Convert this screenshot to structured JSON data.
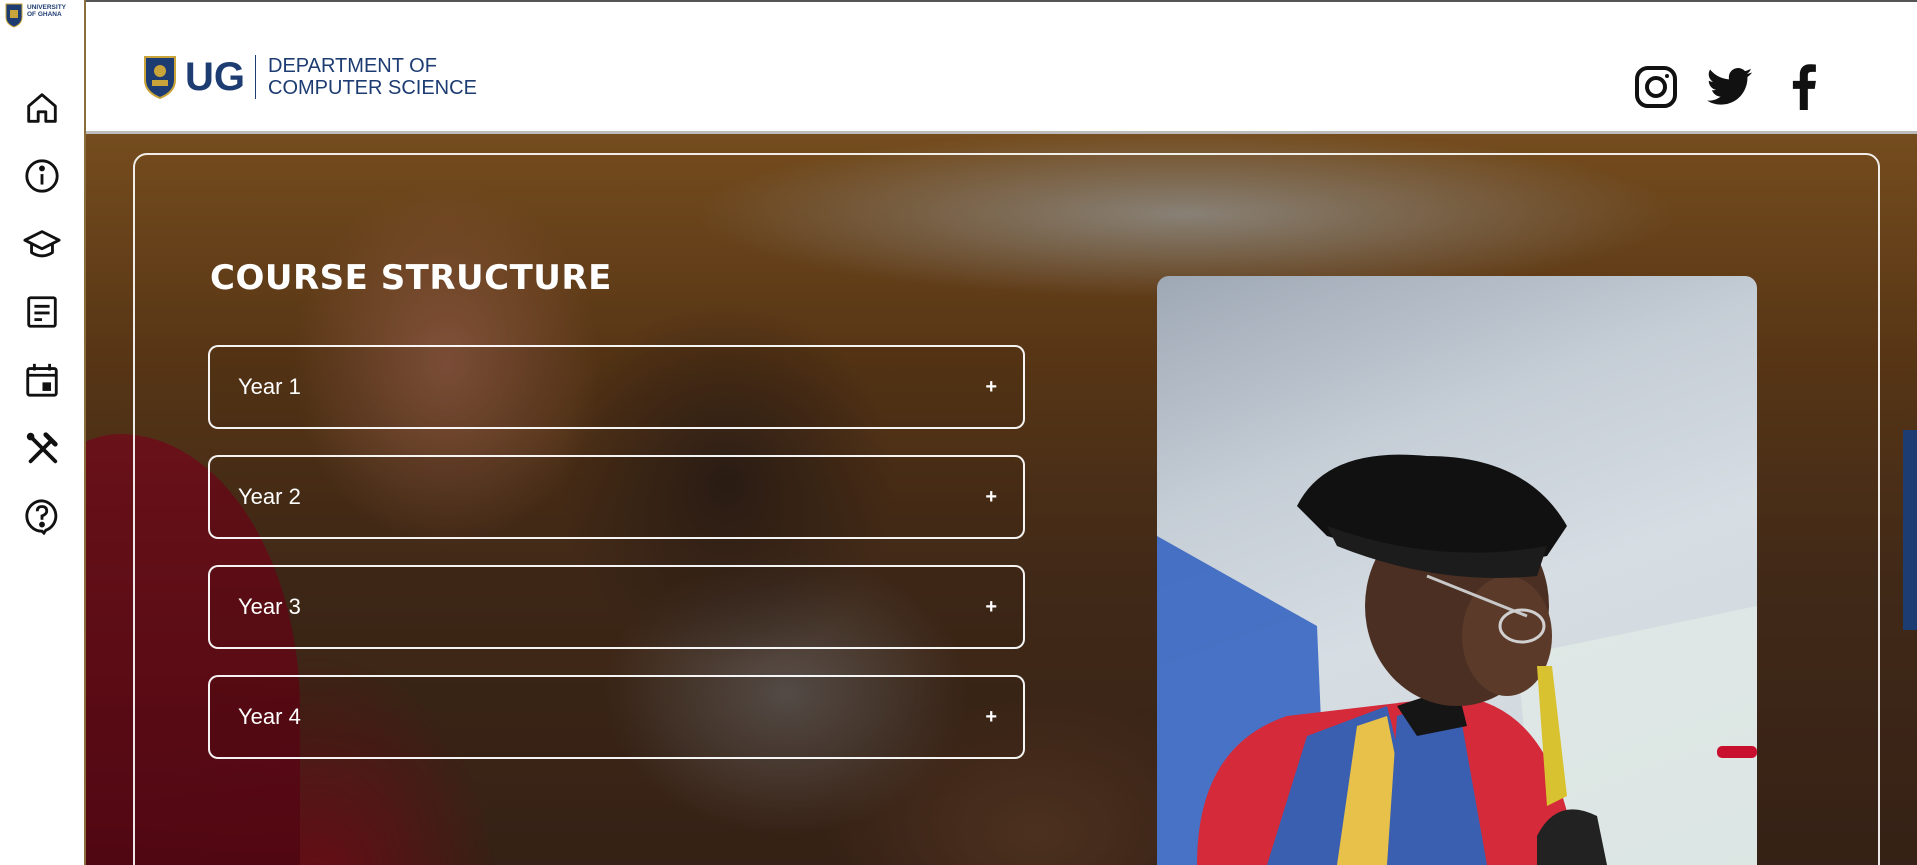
{
  "sidebar": {
    "logo_text_line1": "UNIVERSITY",
    "logo_text_line2": "OF GHANA",
    "items": [
      {
        "name": "home",
        "icon": "home-icon"
      },
      {
        "name": "about",
        "icon": "info-icon"
      },
      {
        "name": "academics",
        "icon": "graduation-cap-icon"
      },
      {
        "name": "documents",
        "icon": "document-icon"
      },
      {
        "name": "events",
        "icon": "calendar-icon"
      },
      {
        "name": "tools",
        "icon": "tools-icon"
      },
      {
        "name": "help",
        "icon": "help-icon"
      }
    ]
  },
  "header": {
    "brand_abbrev": "UG",
    "dept_line1": "DEPARTMENT OF",
    "dept_line2": "COMPUTER SCIENCE",
    "socials": [
      {
        "name": "instagram",
        "icon": "instagram-icon"
      },
      {
        "name": "twitter",
        "icon": "twitter-icon"
      },
      {
        "name": "facebook",
        "icon": "facebook-icon"
      }
    ]
  },
  "main": {
    "title": "COURSE STRUCTURE",
    "accordion": [
      {
        "label": "Year 1",
        "toggle": "+"
      },
      {
        "label": "Year 2",
        "toggle": "+"
      },
      {
        "label": "Year 3",
        "toggle": "+"
      },
      {
        "label": "Year 4",
        "toggle": "+"
      }
    ]
  },
  "colors": {
    "brand_blue": "#1d3c72",
    "sidebar_border": "#8a6d3b",
    "gown_red": "#d42a3a",
    "gown_blue": "#3a5fb0",
    "gown_gold": "#e8c14a"
  }
}
